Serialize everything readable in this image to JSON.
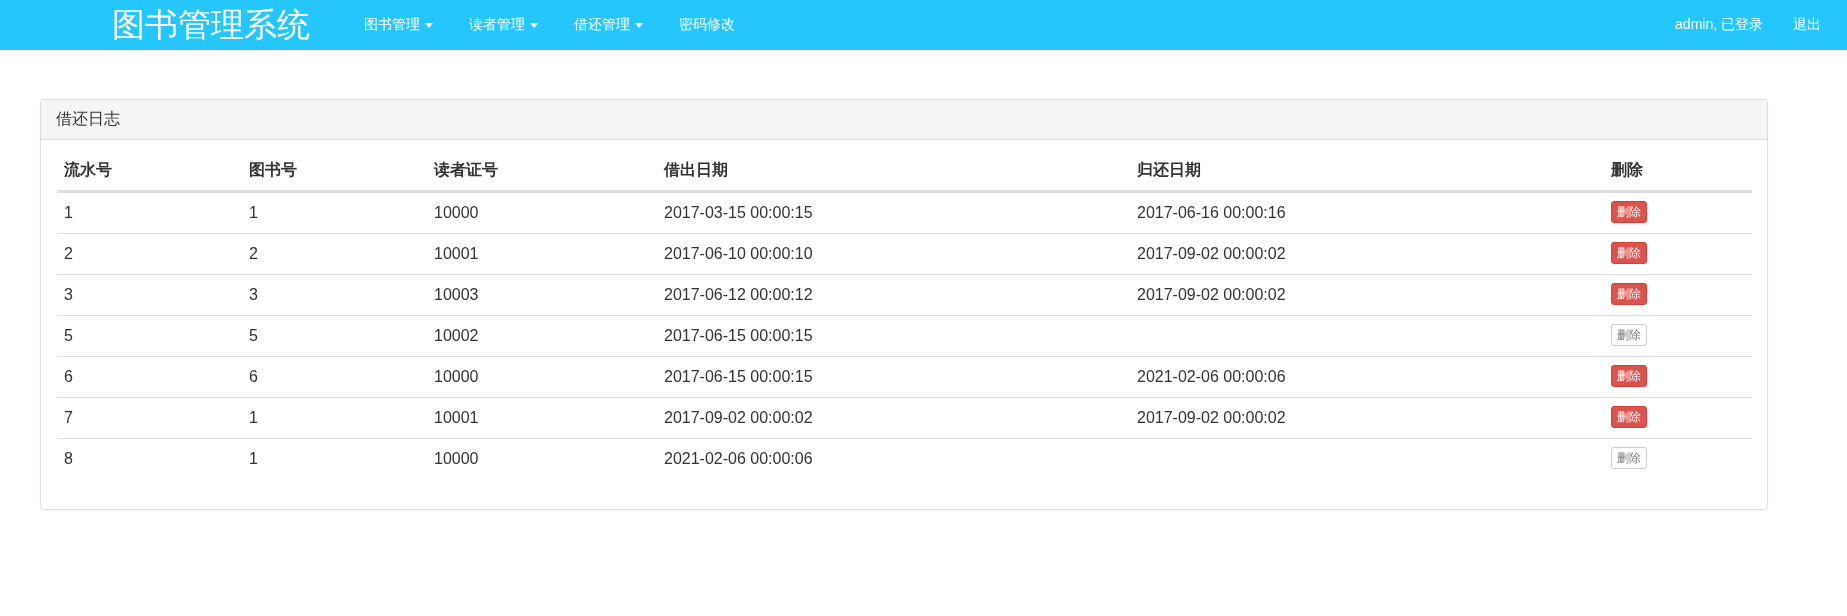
{
  "navbar": {
    "brand": "图书管理系统",
    "menus": [
      {
        "label": "图书管理",
        "dropdown": true
      },
      {
        "label": "读者管理",
        "dropdown": true
      },
      {
        "label": "借还管理",
        "dropdown": true
      },
      {
        "label": "密码修改",
        "dropdown": false
      }
    ],
    "user": "admin, 已登录",
    "logout": "退出"
  },
  "panel": {
    "title": "借还日志",
    "table": {
      "columns": [
        "流水号",
        "图书号",
        "读者证号",
        "借出日期",
        "归还日期",
        "删除"
      ],
      "rows": [
        {
          "cells": [
            "1",
            "1",
            "10000",
            "2017-03-15 00:00:15",
            "2017-06-16 00:00:16"
          ],
          "action": {
            "label": "删除",
            "disabled": false
          }
        },
        {
          "cells": [
            "2",
            "2",
            "10001",
            "2017-06-10 00:00:10",
            "2017-09-02 00:00:02"
          ],
          "action": {
            "label": "删除",
            "disabled": false
          }
        },
        {
          "cells": [
            "3",
            "3",
            "10003",
            "2017-06-12 00:00:12",
            "2017-09-02 00:00:02"
          ],
          "action": {
            "label": "删除",
            "disabled": false
          }
        },
        {
          "cells": [
            "5",
            "5",
            "10002",
            "2017-06-15 00:00:15",
            ""
          ],
          "action": {
            "label": "删除",
            "disabled": true
          }
        },
        {
          "cells": [
            "6",
            "6",
            "10000",
            "2017-06-15 00:00:15",
            "2021-02-06 00:00:06"
          ],
          "action": {
            "label": "删除",
            "disabled": false
          }
        },
        {
          "cells": [
            "7",
            "1",
            "10001",
            "2017-09-02 00:00:02",
            "2017-09-02 00:00:02"
          ],
          "action": {
            "label": "删除",
            "disabled": false
          }
        },
        {
          "cells": [
            "8",
            "1",
            "10000",
            "2021-02-06 00:00:06",
            ""
          ],
          "action": {
            "label": "删除",
            "disabled": true
          }
        }
      ]
    }
  }
}
